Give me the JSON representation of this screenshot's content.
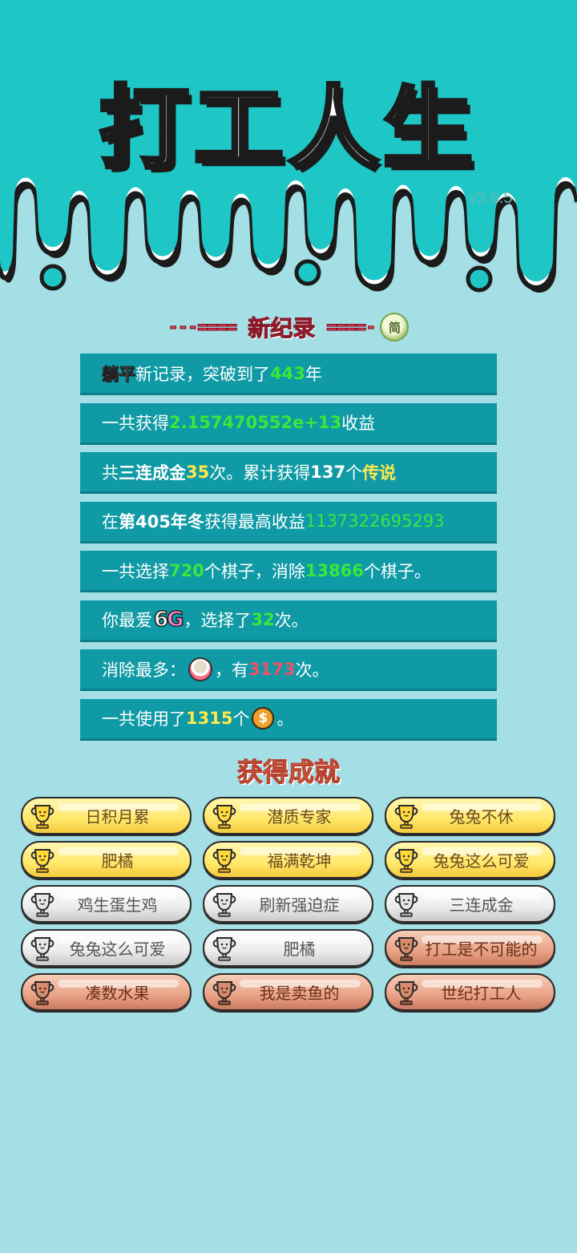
{
  "header": {
    "title": "打工人生",
    "version": "v3.6.5"
  },
  "record_banner": {
    "left_dashes": "---====",
    "title": "新纪录",
    "right_dashes": "====-",
    "lang_button": "简"
  },
  "stats": [
    {
      "parts": [
        {
          "t": "躺平",
          "s": "black"
        },
        {
          "t": "新记录，突破到了"
        },
        {
          "t": "443",
          "s": "green"
        },
        {
          "t": "年"
        }
      ]
    },
    {
      "parts": [
        {
          "t": "一共获得"
        },
        {
          "t": "2.157470552e+13",
          "s": "green"
        },
        {
          "t": "收益"
        }
      ]
    },
    {
      "parts": [
        {
          "t": "共"
        },
        {
          "t": "三连成金",
          "s": "bold"
        },
        {
          "t": "35",
          "s": "yellow"
        },
        {
          "t": "次。累计获得"
        },
        {
          "t": "137",
          "s": "bold"
        },
        {
          "t": "个"
        },
        {
          "t": "传说",
          "s": "yellow"
        }
      ]
    },
    {
      "parts": [
        {
          "t": "在 "
        },
        {
          "t": "第405年冬",
          "s": "bold"
        },
        {
          "t": " 获得最高收益"
        },
        {
          "t": "1137322695293",
          "s": "green-thin"
        }
      ]
    },
    {
      "parts": [
        {
          "t": "一共选择"
        },
        {
          "t": "720",
          "s": "green"
        },
        {
          "t": "个棋子，消除"
        },
        {
          "t": "13866",
          "s": "green"
        },
        {
          "t": "个棋子。"
        }
      ]
    },
    {
      "parts": [
        {
          "t": "你最爱"
        },
        {
          "t": "6G",
          "s": "badge-6g"
        },
        {
          "t": "，选择了"
        },
        {
          "t": "32",
          "s": "green"
        },
        {
          "t": "次。"
        }
      ]
    },
    {
      "parts": [
        {
          "t": "消除最多："
        },
        {
          "t": "rice-bowl-icon",
          "s": "rice-icon"
        },
        {
          "t": "，有"
        },
        {
          "t": "3173",
          "s": "red"
        },
        {
          "t": "次。"
        }
      ]
    },
    {
      "parts": [
        {
          "t": "一共使用了"
        },
        {
          "t": "1315",
          "s": "yellow"
        },
        {
          "t": "个"
        },
        {
          "t": "$",
          "s": "coin-icon"
        },
        {
          "t": "。"
        }
      ]
    }
  ],
  "achievements_title": "获得成就",
  "achievements": [
    {
      "label": "日积月累",
      "tier": "gold"
    },
    {
      "label": "潜质专家",
      "tier": "gold"
    },
    {
      "label": "兔兔不休",
      "tier": "gold"
    },
    {
      "label": "肥橘",
      "tier": "gold"
    },
    {
      "label": "福满乾坤",
      "tier": "gold"
    },
    {
      "label": "兔兔这么可爱",
      "tier": "gold"
    },
    {
      "label": "鸡生蛋生鸡",
      "tier": "silver"
    },
    {
      "label": "刷新强迫症",
      "tier": "silver"
    },
    {
      "label": "三连成金",
      "tier": "silver"
    },
    {
      "label": "兔兔这么可爱",
      "tier": "silver"
    },
    {
      "label": "肥橘",
      "tier": "silver"
    },
    {
      "label": "打工是不可能的",
      "tier": "bronze"
    },
    {
      "label": "凑数水果",
      "tier": "bronze"
    },
    {
      "label": "我是卖鱼的",
      "tier": "bronze"
    },
    {
      "label": "世纪打工人",
      "tier": "bronze"
    }
  ],
  "colors": {
    "background": "#a4dfe5",
    "header_teal": "#1ec6c6",
    "row_teal": "#0f9aa5",
    "highlight_green": "#38e83a",
    "highlight_yellow": "#ffe84a",
    "highlight_red": "#f0506a",
    "gold": "#ffe86a",
    "silver": "#ececec",
    "bronze": "#e9a287"
  }
}
